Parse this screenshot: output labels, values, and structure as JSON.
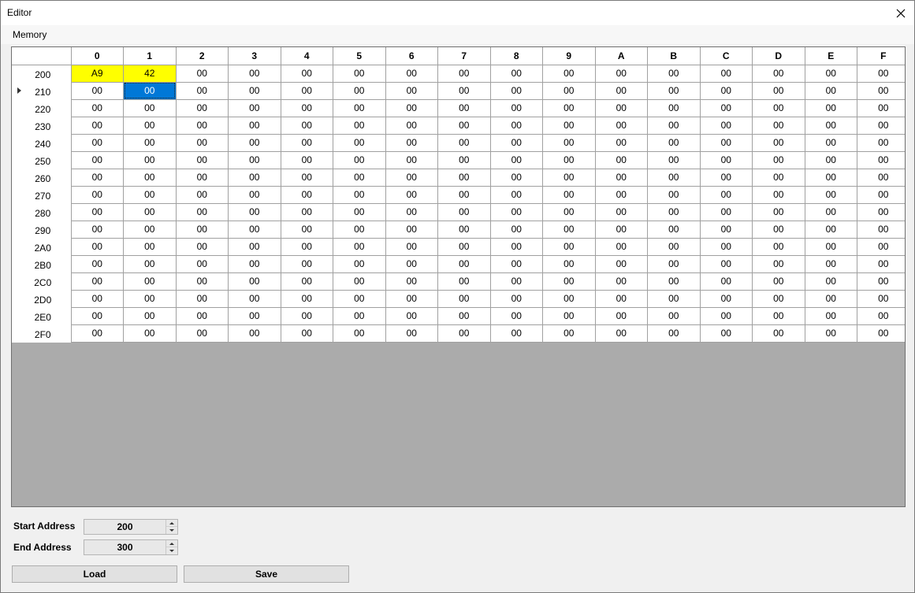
{
  "window": {
    "title": "Editor"
  },
  "menu": {
    "items": [
      "Memory"
    ]
  },
  "grid": {
    "columns": [
      "0",
      "1",
      "2",
      "3",
      "4",
      "5",
      "6",
      "7",
      "8",
      "9",
      "A",
      "B",
      "C",
      "D",
      "E",
      "F"
    ],
    "rows": [
      {
        "addr": "200",
        "cells": [
          "A9",
          "42",
          "00",
          "00",
          "00",
          "00",
          "00",
          "00",
          "00",
          "00",
          "00",
          "00",
          "00",
          "00",
          "00",
          "00"
        ]
      },
      {
        "addr": "210",
        "cells": [
          "00",
          "00",
          "00",
          "00",
          "00",
          "00",
          "00",
          "00",
          "00",
          "00",
          "00",
          "00",
          "00",
          "00",
          "00",
          "00"
        ]
      },
      {
        "addr": "220",
        "cells": [
          "00",
          "00",
          "00",
          "00",
          "00",
          "00",
          "00",
          "00",
          "00",
          "00",
          "00",
          "00",
          "00",
          "00",
          "00",
          "00"
        ]
      },
      {
        "addr": "230",
        "cells": [
          "00",
          "00",
          "00",
          "00",
          "00",
          "00",
          "00",
          "00",
          "00",
          "00",
          "00",
          "00",
          "00",
          "00",
          "00",
          "00"
        ]
      },
      {
        "addr": "240",
        "cells": [
          "00",
          "00",
          "00",
          "00",
          "00",
          "00",
          "00",
          "00",
          "00",
          "00",
          "00",
          "00",
          "00",
          "00",
          "00",
          "00"
        ]
      },
      {
        "addr": "250",
        "cells": [
          "00",
          "00",
          "00",
          "00",
          "00",
          "00",
          "00",
          "00",
          "00",
          "00",
          "00",
          "00",
          "00",
          "00",
          "00",
          "00"
        ]
      },
      {
        "addr": "260",
        "cells": [
          "00",
          "00",
          "00",
          "00",
          "00",
          "00",
          "00",
          "00",
          "00",
          "00",
          "00",
          "00",
          "00",
          "00",
          "00",
          "00"
        ]
      },
      {
        "addr": "270",
        "cells": [
          "00",
          "00",
          "00",
          "00",
          "00",
          "00",
          "00",
          "00",
          "00",
          "00",
          "00",
          "00",
          "00",
          "00",
          "00",
          "00"
        ]
      },
      {
        "addr": "280",
        "cells": [
          "00",
          "00",
          "00",
          "00",
          "00",
          "00",
          "00",
          "00",
          "00",
          "00",
          "00",
          "00",
          "00",
          "00",
          "00",
          "00"
        ]
      },
      {
        "addr": "290",
        "cells": [
          "00",
          "00",
          "00",
          "00",
          "00",
          "00",
          "00",
          "00",
          "00",
          "00",
          "00",
          "00",
          "00",
          "00",
          "00",
          "00"
        ]
      },
      {
        "addr": "2A0",
        "cells": [
          "00",
          "00",
          "00",
          "00",
          "00",
          "00",
          "00",
          "00",
          "00",
          "00",
          "00",
          "00",
          "00",
          "00",
          "00",
          "00"
        ]
      },
      {
        "addr": "2B0",
        "cells": [
          "00",
          "00",
          "00",
          "00",
          "00",
          "00",
          "00",
          "00",
          "00",
          "00",
          "00",
          "00",
          "00",
          "00",
          "00",
          "00"
        ]
      },
      {
        "addr": "2C0",
        "cells": [
          "00",
          "00",
          "00",
          "00",
          "00",
          "00",
          "00",
          "00",
          "00",
          "00",
          "00",
          "00",
          "00",
          "00",
          "00",
          "00"
        ]
      },
      {
        "addr": "2D0",
        "cells": [
          "00",
          "00",
          "00",
          "00",
          "00",
          "00",
          "00",
          "00",
          "00",
          "00",
          "00",
          "00",
          "00",
          "00",
          "00",
          "00"
        ]
      },
      {
        "addr": "2E0",
        "cells": [
          "00",
          "00",
          "00",
          "00",
          "00",
          "00",
          "00",
          "00",
          "00",
          "00",
          "00",
          "00",
          "00",
          "00",
          "00",
          "00"
        ]
      },
      {
        "addr": "2F0",
        "cells": [
          "00",
          "00",
          "00",
          "00",
          "00",
          "00",
          "00",
          "00",
          "00",
          "00",
          "00",
          "00",
          "00",
          "00",
          "00",
          "00"
        ]
      }
    ],
    "current_row": 1,
    "selected_cell": {
      "row": 1,
      "col": 1
    },
    "highlighted_cells": [
      {
        "row": 0,
        "col": 0
      },
      {
        "row": 0,
        "col": 1
      }
    ],
    "highlight_color": "#ffff00",
    "selection_color": "#0078d7",
    "empty_area_color": "#ababab"
  },
  "range": {
    "start_label": "Start Address",
    "start_value": "200",
    "end_label": "End Address",
    "end_value": "300"
  },
  "buttons": {
    "load": "Load",
    "save": "Save"
  }
}
